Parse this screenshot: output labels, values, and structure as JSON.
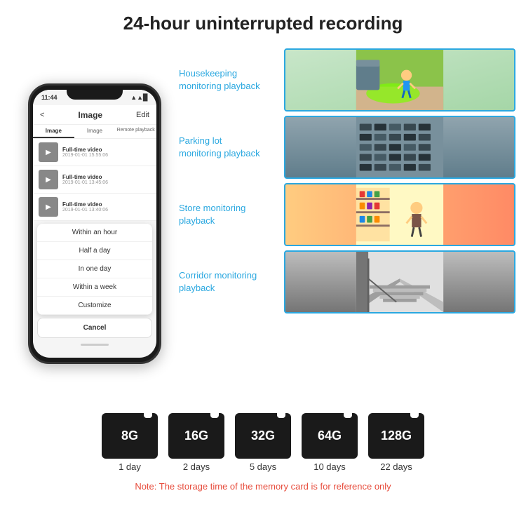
{
  "header": {
    "title": "24-hour uninterrupted recording"
  },
  "phone": {
    "status_time": "11:44",
    "nav_title": "Image",
    "nav_left": "<",
    "nav_right": "Edit",
    "tabs": [
      "Image",
      "Image",
      "Remote playback"
    ],
    "videos": [
      {
        "title": "Full-time video",
        "date": "2019-01-01 15:55:06"
      },
      {
        "title": "Full-time video",
        "date": "2019-01-01 13:45:06"
      },
      {
        "title": "Full-time video",
        "date": "2019-01-01 13:40:06"
      }
    ],
    "dropdown_items": [
      "Within an hour",
      "Half a day",
      "In one day",
      "Within a week",
      "Customize"
    ],
    "cancel_label": "Cancel"
  },
  "monitoring": {
    "items": [
      {
        "label": "Housekeeping\nmonitoring playback",
        "img_class": "housekeeping-img"
      },
      {
        "label": "Parking lot\nmonitoring playback",
        "img_class": "parking-img"
      },
      {
        "label": "Store monitoring\nplayback",
        "img_class": "store-img"
      },
      {
        "label": "Corridor monitoring\nplayback",
        "img_class": "corridor-img"
      }
    ]
  },
  "sdcards": [
    {
      "size": "8G",
      "days": "1 day"
    },
    {
      "size": "16G",
      "days": "2 days"
    },
    {
      "size": "32G",
      "days": "5 days"
    },
    {
      "size": "64G",
      "days": "10 days"
    },
    {
      "size": "128G",
      "days": "22 days"
    }
  ],
  "note": "Note: The storage time of the memory card is for reference only"
}
